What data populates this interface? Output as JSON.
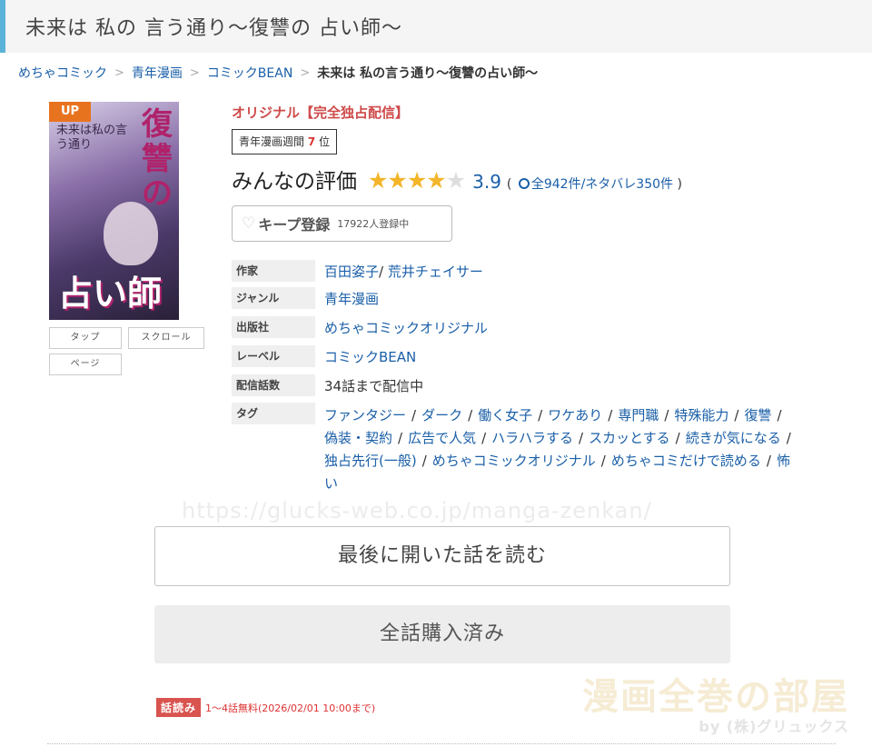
{
  "page": {
    "title": "未来は 私の 言う通り～復讐の 占い師～"
  },
  "breadcrumb": {
    "items": [
      {
        "label": "めちゃコミック"
      },
      {
        "label": "青年漫画"
      },
      {
        "label": "コミックBEAN"
      }
    ],
    "current": "未来は 私の言う通り～復讐の占い師～"
  },
  "cover": {
    "badge": "UP",
    "title_top": "未来は私の言う通り",
    "title_main_1": "復讐の",
    "title_main_2": "占い師"
  },
  "view_buttons": {
    "tap": "タップ",
    "scroll": "スクロール",
    "page": "ページ"
  },
  "book": {
    "original_label": "オリジナル【完全独占配信】",
    "ranking_prefix": "青年漫画週間",
    "ranking_number": "7",
    "ranking_suffix": "位"
  },
  "rating": {
    "label": "みんなの評価",
    "stars_filled": 4,
    "stars_total": 5,
    "score": "3.9",
    "paren_open": "(",
    "total_count": "全942件",
    "separator": "/",
    "spoiler_count": "ネタバレ350件",
    "paren_close": ")"
  },
  "keep": {
    "label": "キープ登録",
    "count": "17922人登録中"
  },
  "info": {
    "author_label": "作家",
    "author_1": "百田姿子",
    "author_sep": "/",
    "author_2": "荒井チェイサー",
    "genre_label": "ジャンル",
    "genre_value": "青年漫画",
    "publisher_label": "出版社",
    "publisher_value": "めちゃコミックオリジナル",
    "label_label": "レーベル",
    "label_value": "コミックBEAN",
    "episodes_label": "配信話数",
    "episodes_value": "34話まで配信中",
    "tags_label": "タグ",
    "tags": [
      "ファンタジー",
      "ダーク",
      "働く女子",
      "ワケあり",
      "専門職",
      "特殊能力",
      "復讐",
      "偽装・契約",
      "広告で人気",
      "ハラハラする",
      "スカッとする",
      "続きが気になる",
      "独占先行(一般)",
      "めちゃコミックオリジナル",
      "めちゃコミだけで読める",
      "怖い"
    ]
  },
  "watermark_url": "https://glucks-web.co.jp/manga-zenkan/",
  "buttons": {
    "read_last": "最後に開いた話を読む",
    "all_purchased": "全話購入済み"
  },
  "logo": {
    "text": "漫画全巻の部屋",
    "by": "by (株)グリュックス"
  },
  "free_reading": {
    "badge": "話読み",
    "text": "1～4話無料(2026/02/01 10:00まで)"
  },
  "colors": {
    "accent_blue": "#5bb3d8",
    "link": "#1a5fa8",
    "original_red": "#cf4a4a",
    "star": "#f3b52a",
    "badge_up": "#e8731f",
    "free_badge": "#d9534f"
  }
}
